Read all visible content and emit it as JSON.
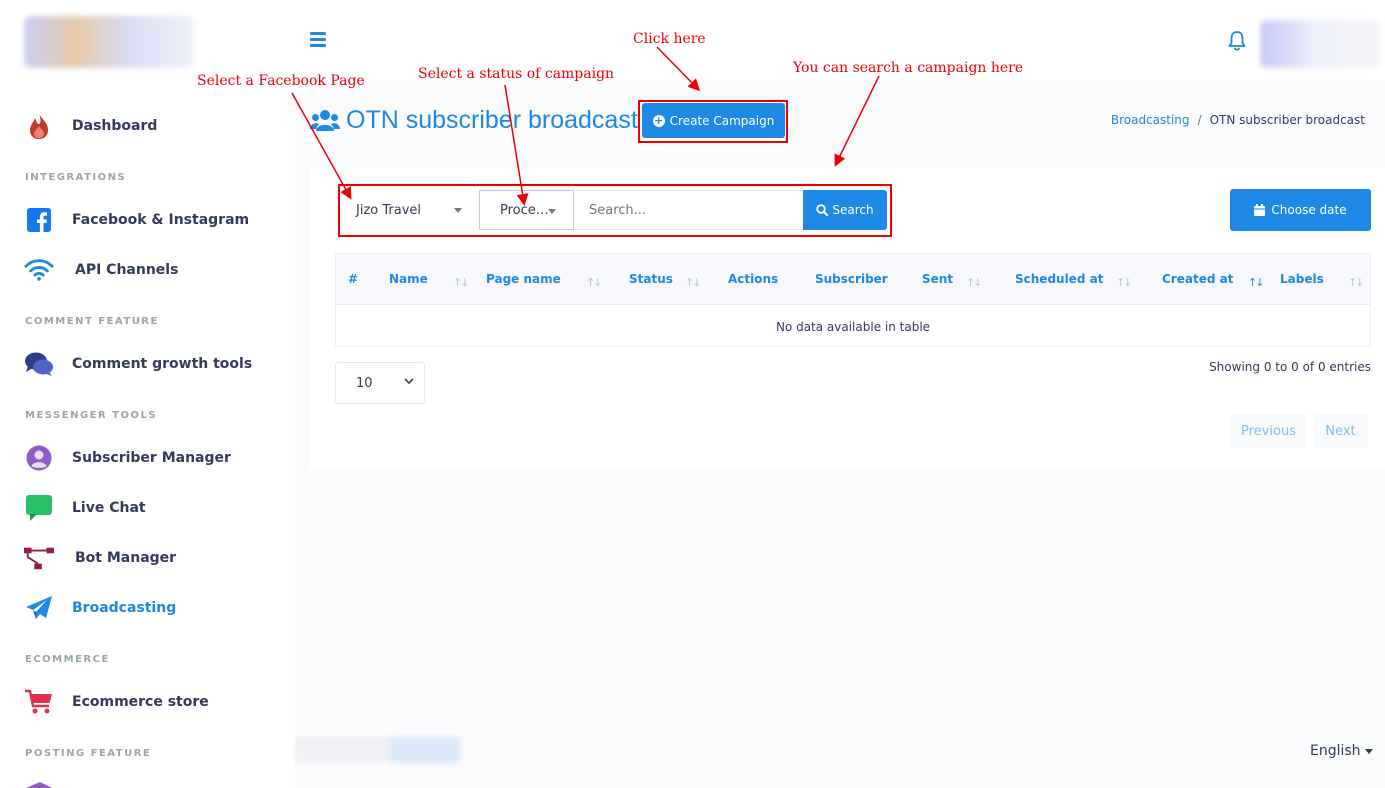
{
  "header": {
    "menu_icon": "hamburger-icon",
    "notification_icon": "bell-icon"
  },
  "sidebar": {
    "items": [
      {
        "label": "Dashboard",
        "icon": "fire-icon"
      },
      {
        "label": "Facebook & Instagram",
        "icon": "facebook-icon"
      },
      {
        "label": "API Channels",
        "icon": "wifi-icon"
      },
      {
        "label": "Comment growth tools",
        "icon": "comments-icon"
      },
      {
        "label": "Subscriber Manager",
        "icon": "user-circle-icon"
      },
      {
        "label": "Live Chat",
        "icon": "chat-bubble-icon"
      },
      {
        "label": "Bot Manager",
        "icon": "sitemap-icon"
      },
      {
        "label": "Broadcasting",
        "icon": "paper-plane-icon"
      },
      {
        "label": "Ecommerce store",
        "icon": "shopping-cart-icon"
      }
    ],
    "headers": {
      "integrations": "INTEGRATIONS",
      "comment_feature": "COMMENT FEATURE",
      "messenger_tools": "MESSENGER TOOLS",
      "ecommerce": "ECOMMERCE",
      "posting_feature": "POSTING FEATURE"
    },
    "active_item": "Broadcasting",
    "colors": {
      "active": "#1e88e5",
      "text": "#34395e"
    }
  },
  "page": {
    "title": "OTN subscriber broadcast",
    "title_icon": "users-icon",
    "create_button": "Create Campaign",
    "breadcrumb": {
      "parent": "Broadcasting",
      "separator": "/",
      "current": "OTN subscriber broadcast"
    }
  },
  "filters": {
    "page_select": "Jizo Travel",
    "status_select": "Proce…",
    "search_placeholder": "Search...",
    "search_button": "Search",
    "date_button": "Choose date"
  },
  "table": {
    "columns": [
      "#",
      "Name",
      "Page name",
      "Status",
      "Actions",
      "Subscriber",
      "Sent",
      "Scheduled at",
      "Created at",
      "Labels"
    ],
    "empty_message": "No data available in table",
    "length": "10",
    "info": "Showing 0 to 0 of 0 entries",
    "previous": "Previous",
    "next": "Next"
  },
  "footer": {
    "language": "English"
  },
  "annotations": {
    "click_here": "Click here",
    "select_page": "Select a Facebook Page",
    "select_status": "Select a status of campaign",
    "search_hint": "You can search a campaign here"
  },
  "colors": {
    "primary": "#1e88e5",
    "annotation": "#ee0000",
    "background": "#fafbfd"
  }
}
